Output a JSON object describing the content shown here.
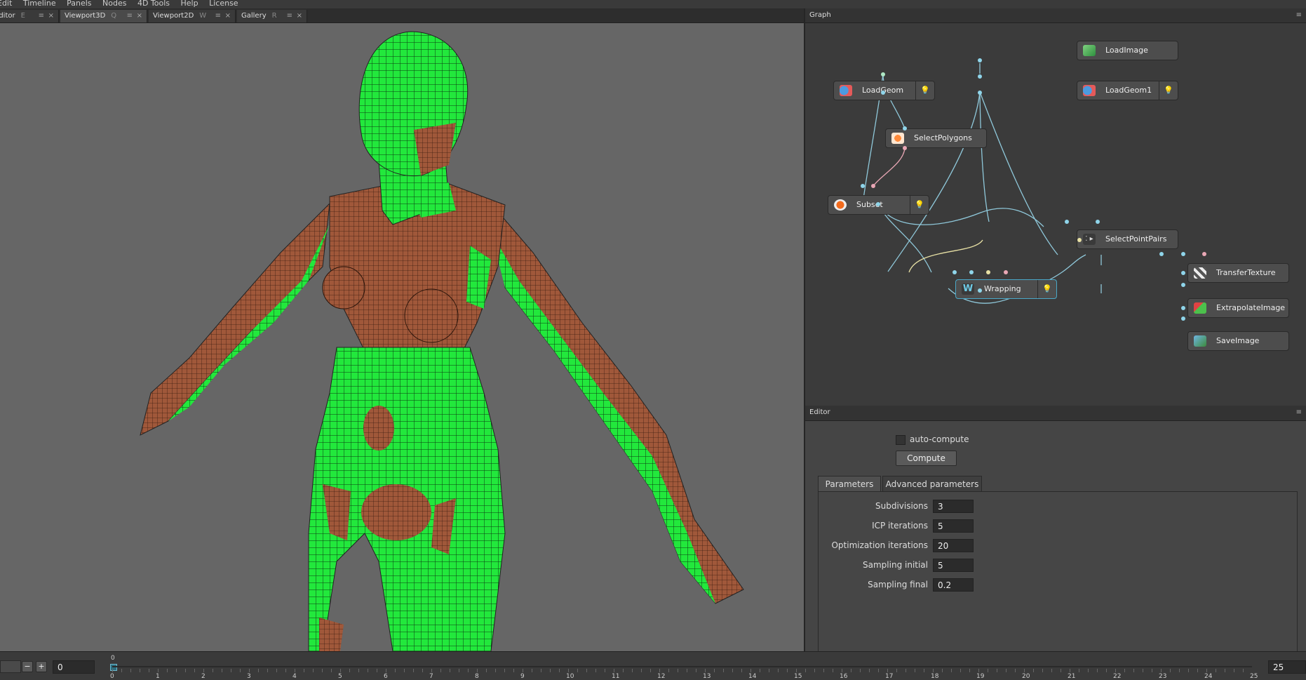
{
  "menu": [
    "Edit",
    "Timeline",
    "Panels",
    "Nodes",
    "4D Tools",
    "Help",
    "License"
  ],
  "viewport_tabs": [
    {
      "label": "Editor",
      "key": "E"
    },
    {
      "label": "Viewport3D",
      "key": "Q"
    },
    {
      "label": "Viewport2D",
      "key": "W"
    },
    {
      "label": "Gallery",
      "key": "R"
    }
  ],
  "graph": {
    "title": "Graph",
    "nodes": {
      "load_image": "LoadImage",
      "load_geom": "LoadGeom",
      "load_geom1": "LoadGeom1",
      "select_polygons": "SelectPolygons",
      "subset": "Subset",
      "select_point_pairs": "SelectPointPairs",
      "wrapping": "Wrapping",
      "transfer_texture": "TransferTexture",
      "extrapolate_image": "ExtrapolateImage",
      "save_image": "SaveImage"
    }
  },
  "editor": {
    "title": "Editor",
    "auto_compute_label": "auto-compute",
    "compute_label": "Compute",
    "tabs": [
      "Parameters",
      "Advanced parameters"
    ],
    "params": [
      {
        "label": "Subdivisions",
        "value": "3"
      },
      {
        "label": "ICP iterations",
        "value": "5"
      },
      {
        "label": "Optimization iterations",
        "value": "20"
      },
      {
        "label": "Sampling initial",
        "value": "5"
      },
      {
        "label": "Sampling final",
        "value": "0.2"
      }
    ]
  },
  "timeline": {
    "current_frame": "0",
    "marker_label": "0",
    "end_frame": "25",
    "ticks": [
      "0",
      "1",
      "2",
      "3",
      "4",
      "5",
      "6",
      "7",
      "8",
      "9",
      "10",
      "11",
      "12",
      "13",
      "14",
      "15",
      "16",
      "17",
      "18",
      "19",
      "20",
      "21",
      "22",
      "23",
      "24",
      "25"
    ],
    "minus": "−",
    "plus": "+"
  },
  "colors": {
    "mesh_green": "#22e83c",
    "mesh_skin": "#a0583a",
    "viewport_bg": "#666666",
    "selection_accent": "#4aa8c8"
  }
}
